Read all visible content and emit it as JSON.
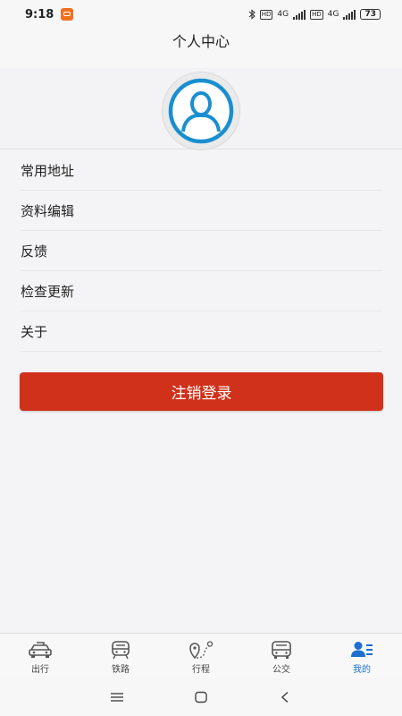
{
  "status_bar": {
    "time": "9:18",
    "network_1": "4G",
    "network_2": "4G",
    "hd_label": "HD",
    "battery": "73"
  },
  "header": {
    "title": "个人中心"
  },
  "profile": {
    "avatar_icon": "user-avatar-icon"
  },
  "menu": {
    "items": [
      {
        "label": "常用地址"
      },
      {
        "label": "资料编辑"
      },
      {
        "label": "反馈"
      },
      {
        "label": "检查更新"
      },
      {
        "label": "关于"
      }
    ]
  },
  "logout": {
    "label": "注销登录",
    "color": "#d0311a"
  },
  "tabs": [
    {
      "label": "出行",
      "icon": "car-icon",
      "active": false
    },
    {
      "label": "铁路",
      "icon": "train-icon",
      "active": false
    },
    {
      "label": "行程",
      "icon": "route-pin-icon",
      "active": false
    },
    {
      "label": "公交",
      "icon": "bus-icon",
      "active": false
    },
    {
      "label": "我的",
      "icon": "user-list-icon",
      "active": true
    }
  ],
  "colors": {
    "accent": "#1e6fd0",
    "avatar_blue": "#1a8fd0"
  }
}
